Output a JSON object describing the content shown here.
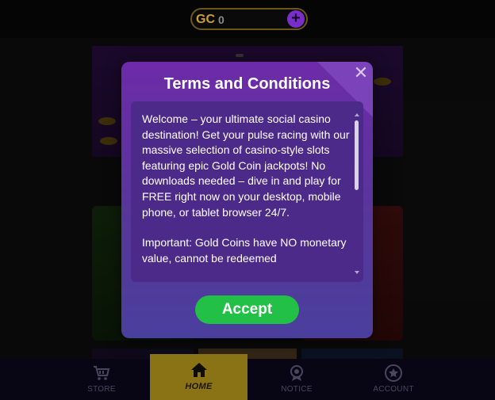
{
  "header": {
    "currency_label": "GC",
    "currency_value": "0",
    "add_icon": "plus-icon",
    "add_glyph": "+"
  },
  "modal": {
    "title": "Terms and Conditions",
    "close_icon": "close-icon",
    "close_glyph": "✕",
    "paragraph_1": "Welcome – your ultimate social casino destination! Get your pulse racing with our massive selection of casino-style slots featuring epic Gold Coin jackpots! No downloads needed – dive in and play for FREE right now on your desktop, mobile phone, or tablet browser 24/7.",
    "paragraph_2": "Important: Gold Coins have NO monetary value, cannot be redeemed",
    "accept_label": "Accept"
  },
  "bottom_nav": {
    "items": [
      {
        "label": "STORE",
        "icon": "cart-icon",
        "active": false
      },
      {
        "label": "HOME",
        "icon": "home-icon",
        "active": true
      },
      {
        "label": "NOTICE",
        "icon": "medal-icon",
        "active": false
      },
      {
        "label": "ACCOUNT",
        "icon": "star-badge-icon",
        "active": false
      }
    ]
  },
  "colors": {
    "modal_top": "#6d2ba8",
    "modal_bottom": "#4a3f9c",
    "accept_green": "#22c046",
    "gold": "#c8a030",
    "home_active": "#8a7314"
  }
}
